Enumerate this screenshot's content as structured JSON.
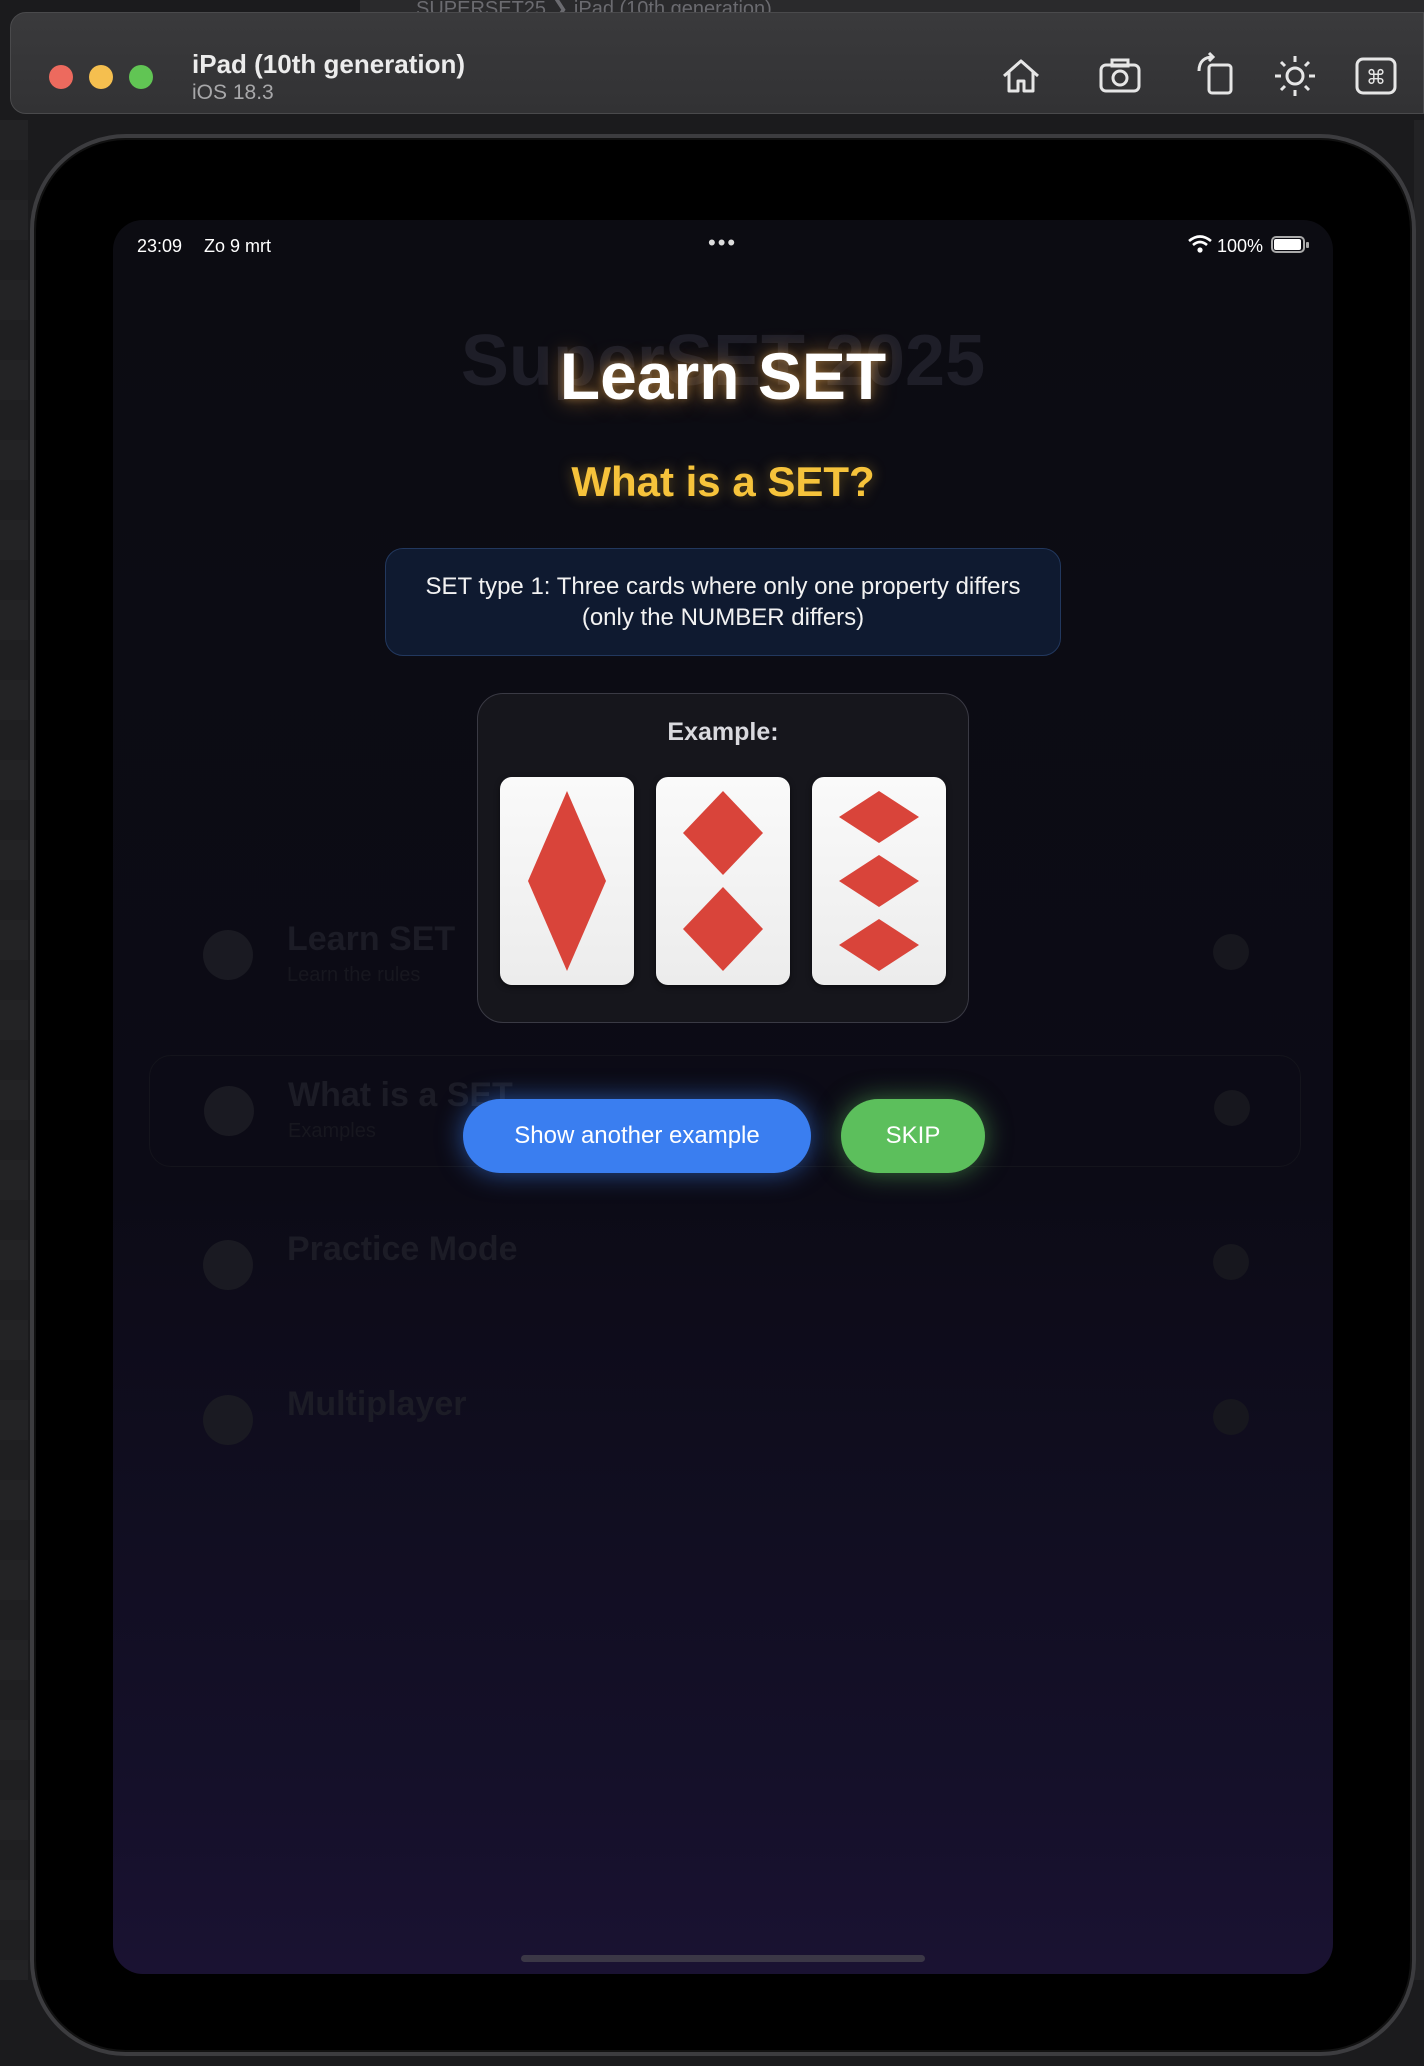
{
  "xcode_bg": {
    "breadcrumb": "SUPERSET25  ❯  iPad (10th generation)"
  },
  "simulator": {
    "device_name": "iPad (10th generation)",
    "os_version": "iOS 18.3",
    "toolbar_icons": [
      "home-icon",
      "screenshot-icon",
      "rotate-icon",
      "appearance-icon",
      "command-icon"
    ]
  },
  "status_bar": {
    "time": "23:09",
    "date": "Zo 9 mrt",
    "multitask_dots": "•••",
    "battery_percent": "100%"
  },
  "background_menu": {
    "title": "SuperSET 2025",
    "items": [
      {
        "label": "Learn SET",
        "sub": "Learn the rules"
      },
      {
        "label": "What is a SET",
        "sub": "Examples"
      },
      {
        "label": "Practice Mode",
        "sub": ""
      },
      {
        "label": "Multiplayer",
        "sub": ""
      }
    ]
  },
  "overlay": {
    "title": "Learn SET",
    "subtitle": "What is a SET?",
    "description_line1": "SET type 1: Three cards where only one property differs",
    "description_line2": "(only the NUMBER differs)",
    "example_label": "Example:",
    "cards": [
      {
        "shape": "diamond",
        "count": 1,
        "color": "#d9443a",
        "fill": "solid"
      },
      {
        "shape": "diamond",
        "count": 2,
        "color": "#d9443a",
        "fill": "solid"
      },
      {
        "shape": "diamond",
        "count": 3,
        "color": "#d9443a",
        "fill": "solid"
      }
    ],
    "show_another_label": "Show another example",
    "skip_label": "SKIP"
  },
  "colors": {
    "accent_blue": "#3a7ef0",
    "accent_green": "#5cbf5c",
    "title_yellow": "#f6c33b",
    "card_red": "#d9443a"
  }
}
